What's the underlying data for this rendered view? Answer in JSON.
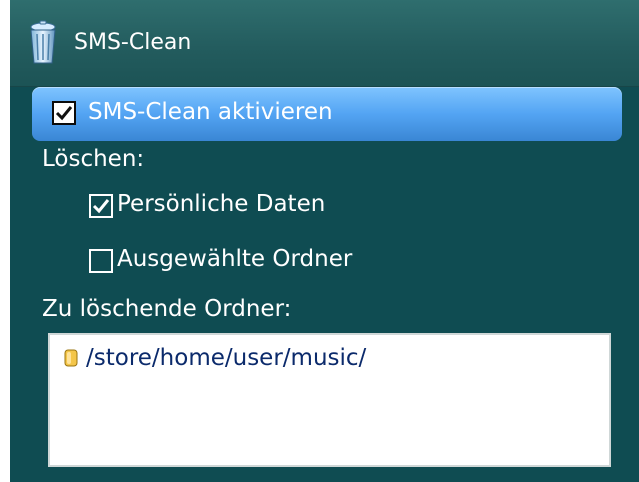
{
  "app": {
    "title": "SMS-Clean",
    "icon": "trash-can-icon"
  },
  "options": {
    "activate": {
      "label": "SMS-Clean aktivieren",
      "checked": true
    },
    "delete_heading": "Löschen:",
    "personal_data": {
      "label": "Persönliche Daten",
      "checked": true
    },
    "selected_folders": {
      "label": "Ausgewählte Ordner",
      "checked": false
    },
    "folders_heading": "Zu löschende Ordner:"
  },
  "folder_list": {
    "items": [
      {
        "path": "/store/home/user/music/",
        "icon": "folder-icon"
      }
    ]
  },
  "colors": {
    "panel_bg": "#0f4c52",
    "titlebar": "#235c5e",
    "highlight": "#53a4f3",
    "list_text": "#0b2a6b"
  }
}
